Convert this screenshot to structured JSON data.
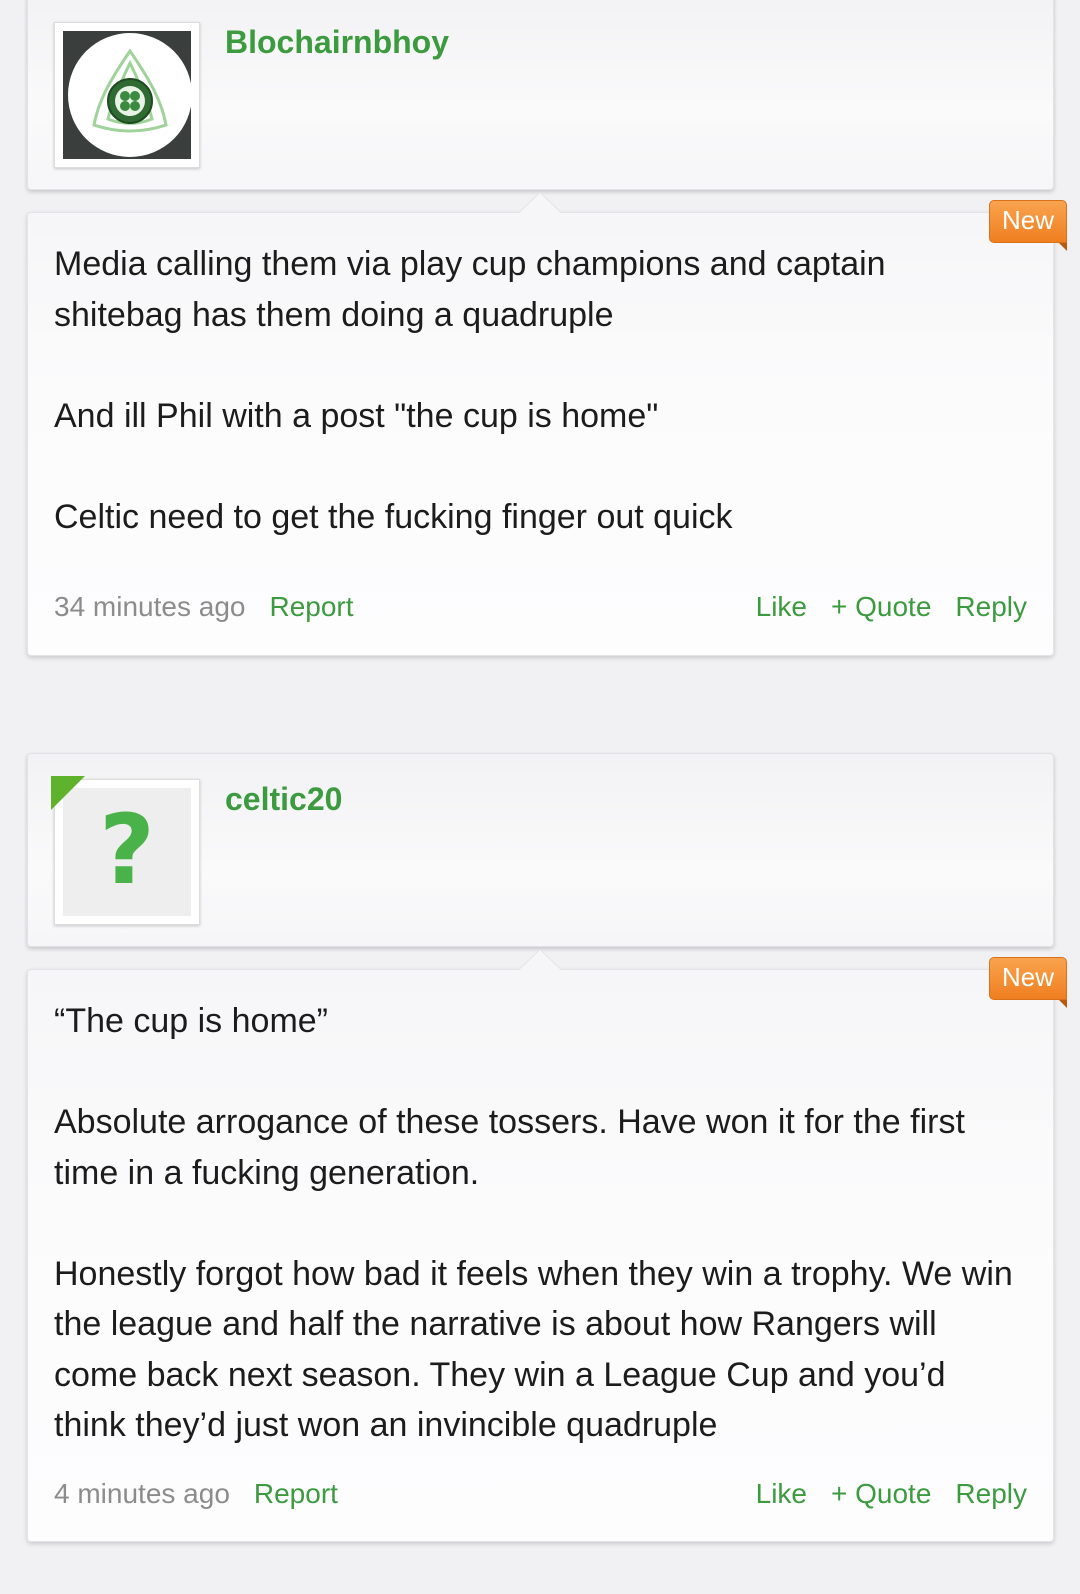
{
  "posts": [
    {
      "username": "Blochairnbhoy",
      "avatar": "celtic-crest-avatar",
      "new_badge": "New",
      "paragraphs": [
        "Media calling them via play cup champions and captain shitebag has them doing a quadruple",
        "And ill Phil with a post \"the cup is home\"",
        "Celtic need to get the fucking finger out quick"
      ],
      "time": "34 minutes ago",
      "report": "Report",
      "like": "Like",
      "quote": "+ Quote",
      "reply": "Reply"
    },
    {
      "username": "celtic20",
      "avatar": "question-mark-default-avatar",
      "avatar_glyph": "?",
      "new_badge": "New",
      "paragraphs": [
        "“The cup is home”",
        "Absolute arrogance of these tossers. Have won it for the first time in a fucking generation.",
        "Honestly forgot how bad it feels when they win a trophy. We win the league and half the narrative is about how Rangers will come back next season. They win a League Cup and you’d think they’d just won an invincible quadruple"
      ],
      "time": "4 minutes ago",
      "report": "Report",
      "like": "Like",
      "quote": "+ Quote",
      "reply": "Reply"
    }
  ],
  "colors": {
    "accent_green": "#3c9a3f",
    "badge_orange": "#f08a2a",
    "avatar_corner": "#5fb22c"
  }
}
